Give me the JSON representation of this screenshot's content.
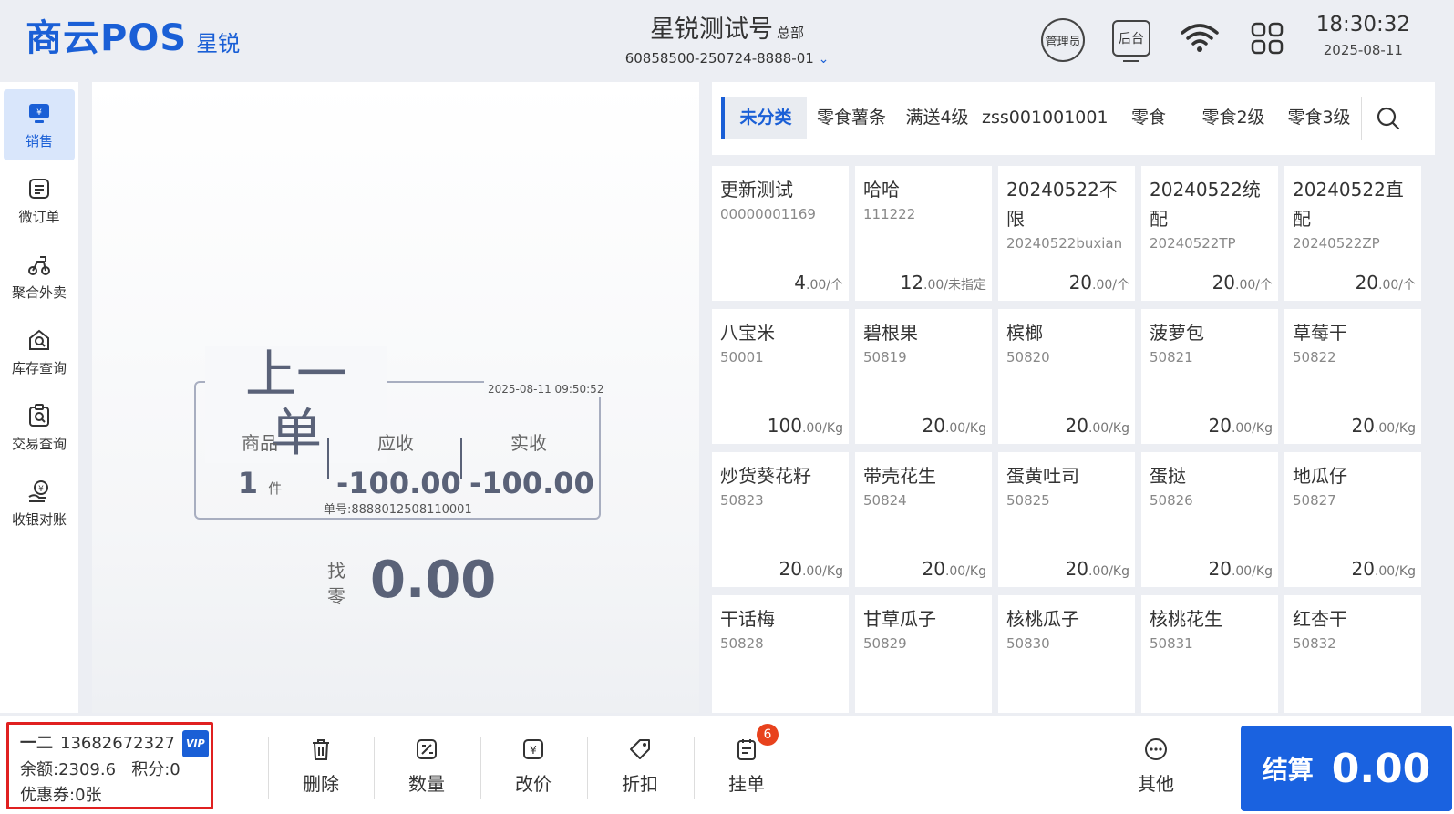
{
  "header": {
    "logo_main": "商云POS",
    "logo_sub": "星锐",
    "store_name": "星锐测试号",
    "store_tag": "总部",
    "store_code": "60858500-250724-8888-01",
    "admin_label": "管理员",
    "backend_label": "后台",
    "time": "18:30:32",
    "date": "2025-08-11"
  },
  "sidebar": {
    "items": [
      {
        "label": "销售",
        "icon": "sales-icon"
      },
      {
        "label": "微订单",
        "icon": "order-icon"
      },
      {
        "label": "聚合外卖",
        "icon": "delivery-icon"
      },
      {
        "label": "库存查询",
        "icon": "inventory-icon"
      },
      {
        "label": "交易查询",
        "icon": "transaction-icon"
      },
      {
        "label": "收银对账",
        "icon": "reconcile-icon"
      }
    ]
  },
  "receipt": {
    "title": "上一单",
    "time": "2025-08-11 09:50:52",
    "goods_label": "商品",
    "goods_count": "1",
    "goods_unit": "件",
    "receivable_label": "应收",
    "receivable_value": "-100.00",
    "received_label": "实收",
    "received_value": "-100.00",
    "order_no": "单号:8888012508110001",
    "change_label": "找零",
    "change_value": "0.00"
  },
  "categories": [
    {
      "label": "未分类",
      "active": true
    },
    {
      "label": "零食薯条"
    },
    {
      "label": "满送4级"
    },
    {
      "label": "zss001001001"
    },
    {
      "label": "零食"
    },
    {
      "label": "零食2级"
    },
    {
      "label": "零食3级"
    }
  ],
  "products": [
    {
      "name": "更新测试",
      "code": "00000001169",
      "price": "4",
      "dec": ".00",
      "unit": "/个"
    },
    {
      "name": "哈哈",
      "code": "111222",
      "price": "12",
      "dec": ".00",
      "unit": "/未指定"
    },
    {
      "name": "20240522不限",
      "code": "20240522buxian",
      "price": "20",
      "dec": ".00",
      "unit": "/个"
    },
    {
      "name": "20240522统配",
      "code": "20240522TP",
      "price": "20",
      "dec": ".00",
      "unit": "/个"
    },
    {
      "name": "20240522直配",
      "code": "20240522ZP",
      "price": "20",
      "dec": ".00",
      "unit": "/个"
    },
    {
      "name": "八宝米",
      "code": "50001",
      "price": "100",
      "dec": ".00",
      "unit": "/Kg"
    },
    {
      "name": "碧根果",
      "code": "50819",
      "price": "20",
      "dec": ".00",
      "unit": "/Kg"
    },
    {
      "name": "槟榔",
      "code": "50820",
      "price": "20",
      "dec": ".00",
      "unit": "/Kg"
    },
    {
      "name": "菠萝包",
      "code": "50821",
      "price": "20",
      "dec": ".00",
      "unit": "/Kg"
    },
    {
      "name": "草莓干",
      "code": "50822",
      "price": "20",
      "dec": ".00",
      "unit": "/Kg"
    },
    {
      "name": "炒货葵花籽",
      "code": "50823",
      "price": "20",
      "dec": ".00",
      "unit": "/Kg"
    },
    {
      "name": "带壳花生",
      "code": "50824",
      "price": "20",
      "dec": ".00",
      "unit": "/Kg"
    },
    {
      "name": "蛋黄吐司",
      "code": "50825",
      "price": "20",
      "dec": ".00",
      "unit": "/Kg"
    },
    {
      "name": "蛋挞",
      "code": "50826",
      "price": "20",
      "dec": ".00",
      "unit": "/Kg"
    },
    {
      "name": "地瓜仔",
      "code": "50827",
      "price": "20",
      "dec": ".00",
      "unit": "/Kg"
    },
    {
      "name": "干话梅",
      "code": "50828",
      "price": "",
      "dec": "",
      "unit": ""
    },
    {
      "name": "甘草瓜子",
      "code": "50829",
      "price": "",
      "dec": "",
      "unit": ""
    },
    {
      "name": "核桃瓜子",
      "code": "50830",
      "price": "",
      "dec": "",
      "unit": ""
    },
    {
      "name": "核桃花生",
      "code": "50831",
      "price": "",
      "dec": "",
      "unit": ""
    },
    {
      "name": "红杏干",
      "code": "50832",
      "price": "",
      "dec": "",
      "unit": ""
    }
  ],
  "member": {
    "name": "一二",
    "phone": "13682672327",
    "vip": "VIP",
    "balance": "余额:2309.6",
    "points": "积分:0",
    "coupons": "优惠券:0张"
  },
  "actions": [
    {
      "label": "删除",
      "icon": "trash-icon"
    },
    {
      "label": "数量",
      "icon": "quantity-icon"
    },
    {
      "label": "改价",
      "icon": "price-change-icon"
    },
    {
      "label": "折扣",
      "icon": "discount-tag-icon"
    },
    {
      "label": "挂单",
      "icon": "hold-order-icon"
    }
  ],
  "hold_badge": "6",
  "other_label": "其他",
  "checkout": {
    "label": "结算",
    "value": "0.00"
  },
  "colors": {
    "accent": "#1a62e0",
    "badge": "#e8421d",
    "member_border": "#e02020"
  }
}
